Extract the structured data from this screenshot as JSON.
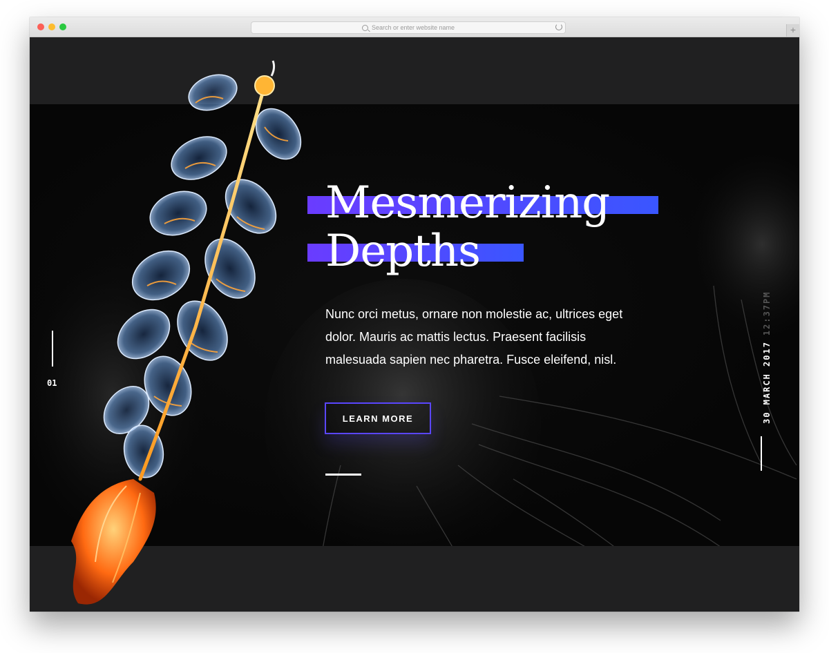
{
  "browser": {
    "address_placeholder": "Search or enter website name",
    "newtab_symbol": "+"
  },
  "hero": {
    "title_line1": "Mesmerizing",
    "title_line2": "Depths",
    "description": "Nunc orci metus, ornare non molestie ac, ultrices eget dolor. Mauris ac mattis lectus. Praesent facilisis malesuada sapien nec pharetra. Fusce eleifend, nisl.",
    "cta_label": "LEARN MORE",
    "accent_colors": [
      "#6a3cff",
      "#3a56ff"
    ]
  },
  "slider": {
    "current_slide": "01"
  },
  "meta": {
    "date": "30 MARCH 2017",
    "time": "12:37PM"
  },
  "icons": {
    "search": "search-icon",
    "reload": "reload-icon",
    "window_controls": [
      "close-icon",
      "minimize-icon",
      "zoom-icon"
    ]
  }
}
